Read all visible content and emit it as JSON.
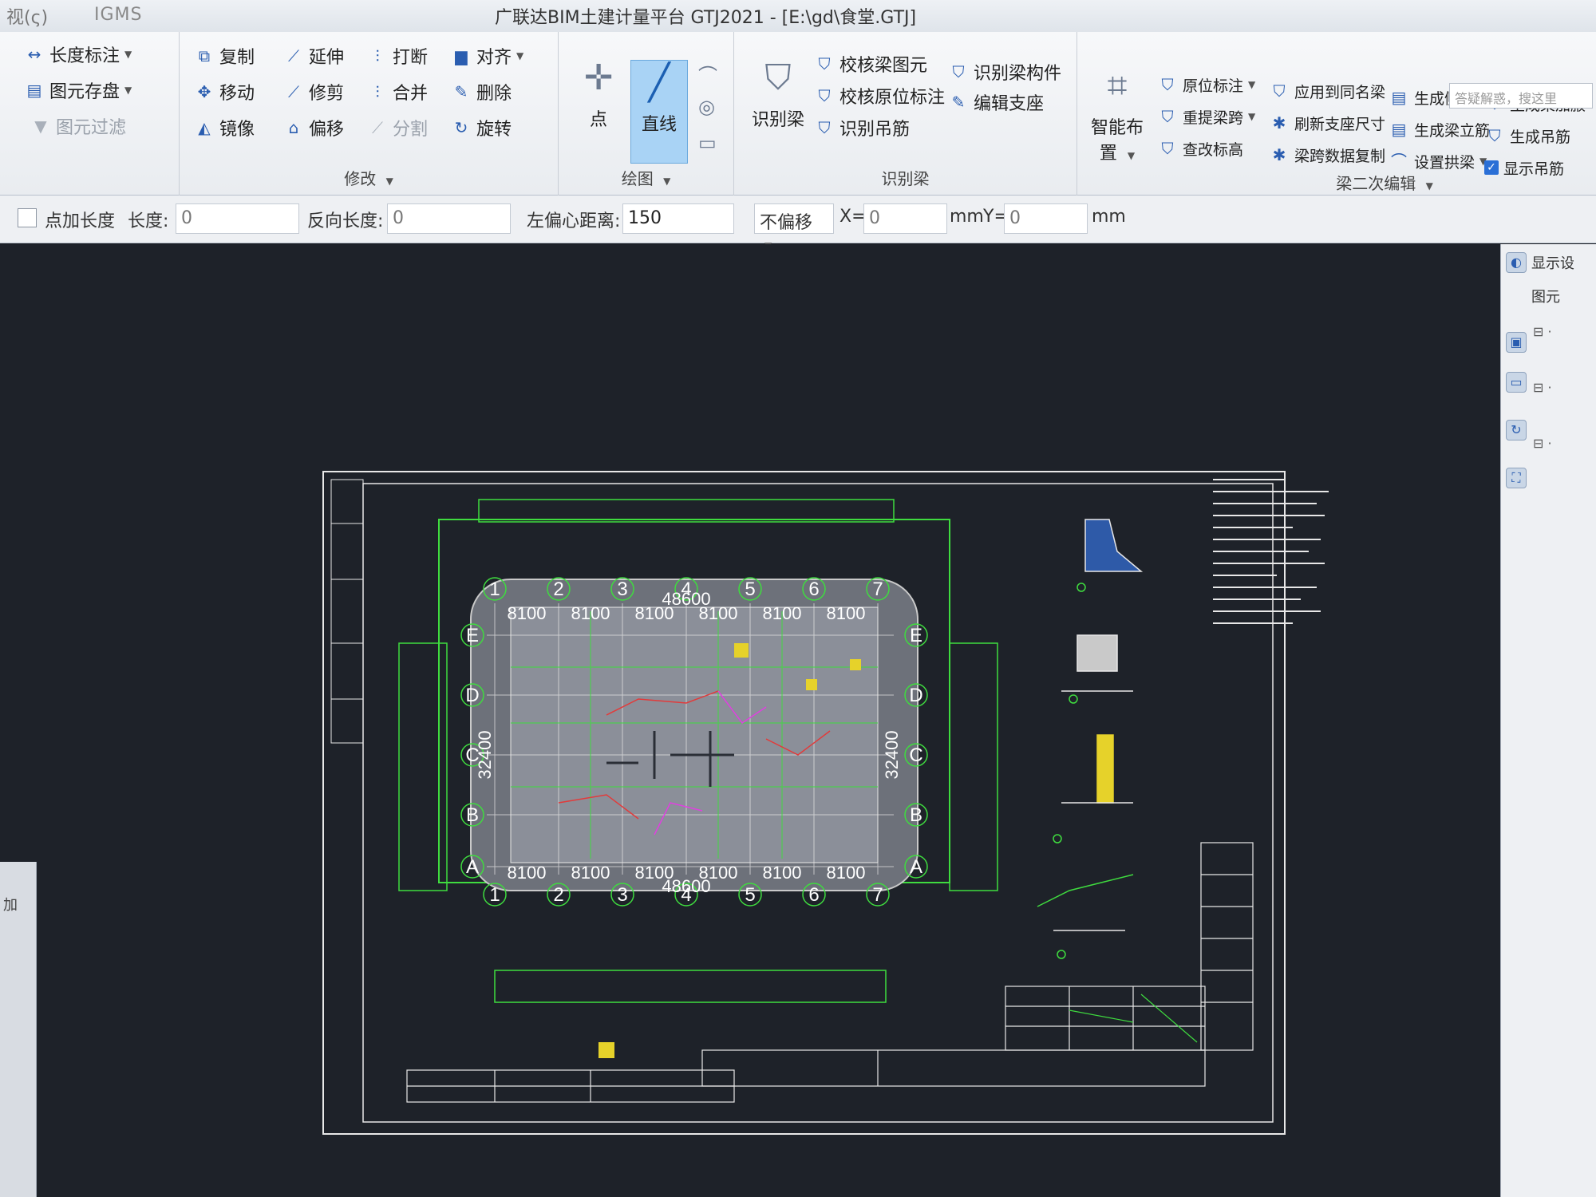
{
  "titlebar": {
    "left_text": "视(ς)",
    "igms": "IGMS",
    "title": "广联达BIM土建计量平台 GTJ2021 - [E:\\gd\\食堂.GTJ]"
  },
  "ribbon": {
    "left": {
      "length_annotation": "长度标注",
      "element_storage": "图元存盘",
      "element_filter": "图元过滤"
    },
    "modify": {
      "label": "修改",
      "copy": "复制",
      "extend": "延伸",
      "break": "打断",
      "align": "对齐",
      "move": "移动",
      "trim": "修剪",
      "merge": "合并",
      "delete": "删除",
      "mirror": "镜像",
      "offset": "偏移",
      "split": "分割",
      "rotate": "旋转"
    },
    "draw": {
      "label": "绘图",
      "point": "点",
      "line": "直线"
    },
    "identify_beam": {
      "label": "识别梁",
      "identify_beam_btn": "识别梁",
      "check_beam_element": "校核梁图元",
      "identify_beam_component": "识别梁构件",
      "check_in_place_annotation": "校核原位标注",
      "edit_support": "编辑支座",
      "identify_hanging_bar": "识别吊筋"
    },
    "secondary_edit": {
      "label": "梁二次编辑",
      "smart_layout": "智能布置",
      "in_place_annotation": "原位标注",
      "apply_same_name_beam": "应用到同名梁",
      "generate_side_bar": "生成侧面筋",
      "generate_beam_haunch": "生成梁加腋",
      "re_extract_span": "重提梁跨",
      "refresh_support_size": "刷新支座尺寸",
      "generate_stirrup": "生成梁立筋",
      "generate_hanging_bar": "生成吊筋",
      "modify_elevation": "查改标高",
      "copy_span_data": "梁跨数据复制",
      "set_arch_beam": "设置拱梁",
      "show_hanging_bar": "显示吊筋"
    },
    "search_placeholder": "答疑解惑，搜这里"
  },
  "options": {
    "add_length_checkbox": "点加长度",
    "length_label": "长度:",
    "length_value": "0",
    "reverse_length_label": "反向长度:",
    "reverse_length_value": "0",
    "left_offset_label": "左偏心距离:",
    "left_offset_value": "150",
    "offset_mode": "不偏移",
    "x_label": "X=",
    "x_value": "0",
    "mm1": "mm",
    "y_label": "Y=",
    "y_value": "0",
    "mm2": "mm"
  },
  "drawing": {
    "axis_numbers": [
      "1",
      "2",
      "3",
      "4",
      "5",
      "6",
      "7"
    ],
    "axis_letters": [
      "E",
      "D",
      "C",
      "B",
      "A"
    ],
    "span_label": "8100",
    "total_width": "48600",
    "total_depth": "32400"
  },
  "right_panel": {
    "tab_display": "显示设",
    "tab_element": "图元"
  },
  "left_strip": {
    "add_label": "加"
  },
  "colors": {
    "canvas_bg": "#1e2229",
    "cad_green": "#3fdc3f",
    "cad_white": "#e8e8e8",
    "cad_yellow": "#e6d22a",
    "cad_red": "#e33a3a",
    "cad_magenta": "#e040e0",
    "cad_gray": "#8b8f99",
    "ribbon_active": "#a9d3f5"
  }
}
